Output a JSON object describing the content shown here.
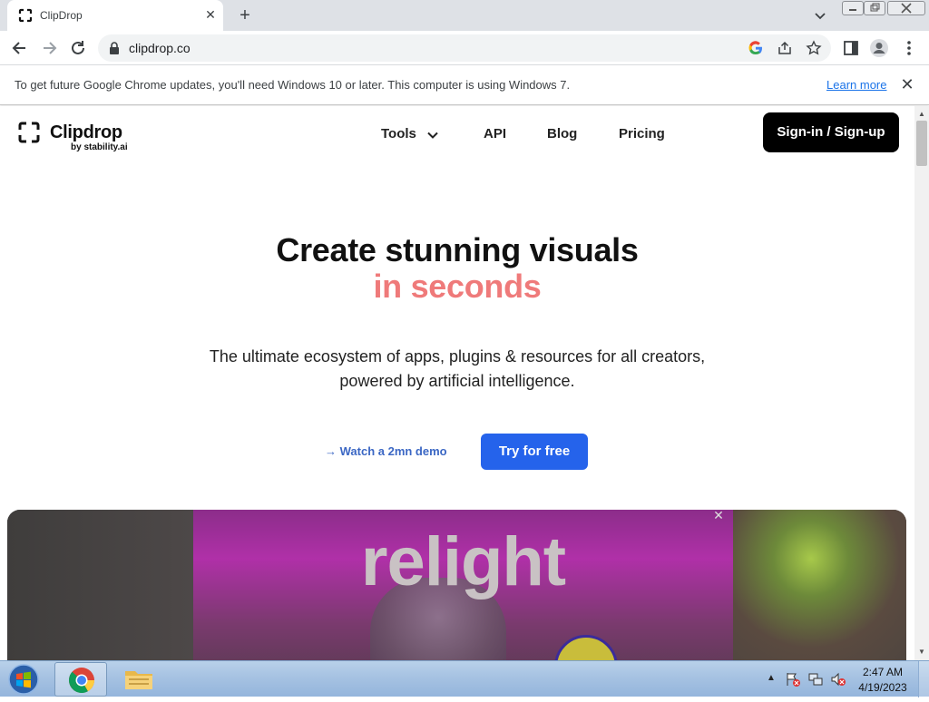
{
  "browser": {
    "tab_title": "ClipDrop",
    "url": "clipdrop.co",
    "infobar_message": "To get future Google Chrome updates, you'll need Windows 10 or later. This computer is using Windows 7.",
    "infobar_link": "Learn more"
  },
  "site": {
    "logo_text": "Clipdrop",
    "logo_sub": "by stability.ai",
    "nav": {
      "tools": "Tools",
      "api": "API",
      "blog": "Blog",
      "pricing": "Pricing"
    },
    "signin_label": "Sign-in / Sign-up",
    "headline_line1": "Create stunning visuals",
    "headline_line2": "in seconds",
    "subtitle_line1": "The ultimate ecosystem of apps, plugins & resources for all creators,",
    "subtitle_line2": "powered by artificial intelligence.",
    "demo_link": "→ Watch a 2mn demo",
    "cta_label": "Try for free",
    "hero_word": "relight",
    "colors": {
      "accent_pink": "#ef7a7a",
      "cta_blue": "#2563eb",
      "link_blue": "#3b67c4"
    }
  },
  "taskbar": {
    "time": "2:47 AM",
    "date": "4/19/2023"
  }
}
